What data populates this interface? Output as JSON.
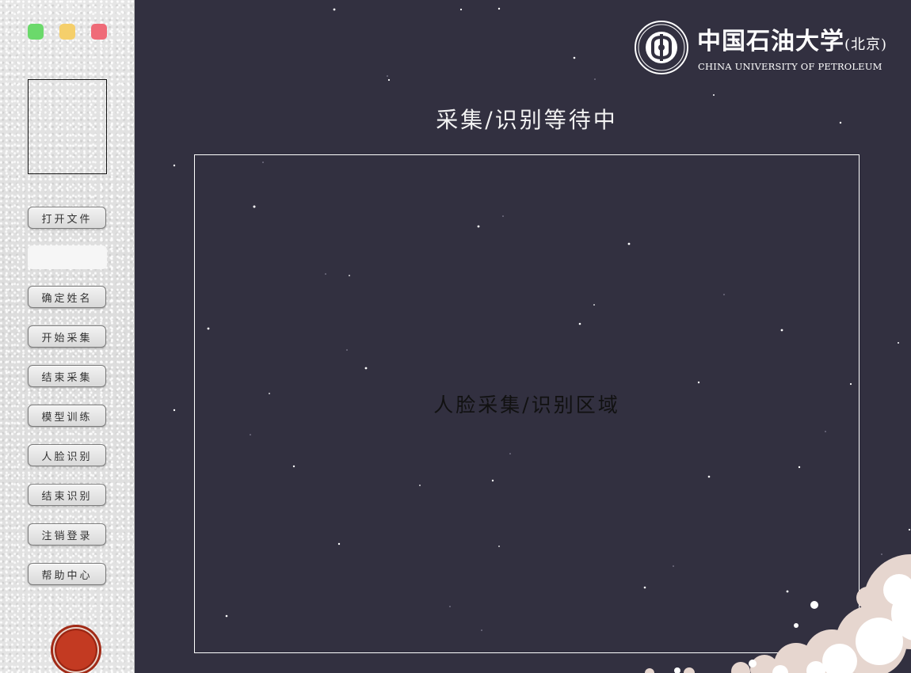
{
  "sidebar": {
    "window_controls": [
      {
        "name": "green",
        "color": "#6bd96b"
      },
      {
        "name": "yellow",
        "color": "#f5cf6b"
      },
      {
        "name": "red",
        "color": "#ef6b78"
      }
    ],
    "buttons": {
      "open_file": "打开文件",
      "confirm_name": "确定姓名",
      "start_capture": "开始采集",
      "end_capture": "结束采集",
      "train_model": "模型训练",
      "face_recognition": "人脸识别",
      "end_recognition": "结束识别",
      "logout": "注销登录",
      "help_center": "帮助中心"
    },
    "name_input": {
      "value": "",
      "placeholder": ""
    }
  },
  "header": {
    "logo": {
      "title": "中国石油大学",
      "suffix": "(北京)",
      "subtitle": "CHINA UNIVERSITY OF PETROLEUM",
      "emblem_icon": "university-emblem-icon"
    }
  },
  "main": {
    "status": "采集/识别等待中",
    "capture_area_label": "人脸采集/识别区域"
  },
  "colors": {
    "background": "#323040",
    "sidebar": "#e2e2e2",
    "accent_seal": "#c33a22",
    "cloud": "#e6d6cf"
  }
}
